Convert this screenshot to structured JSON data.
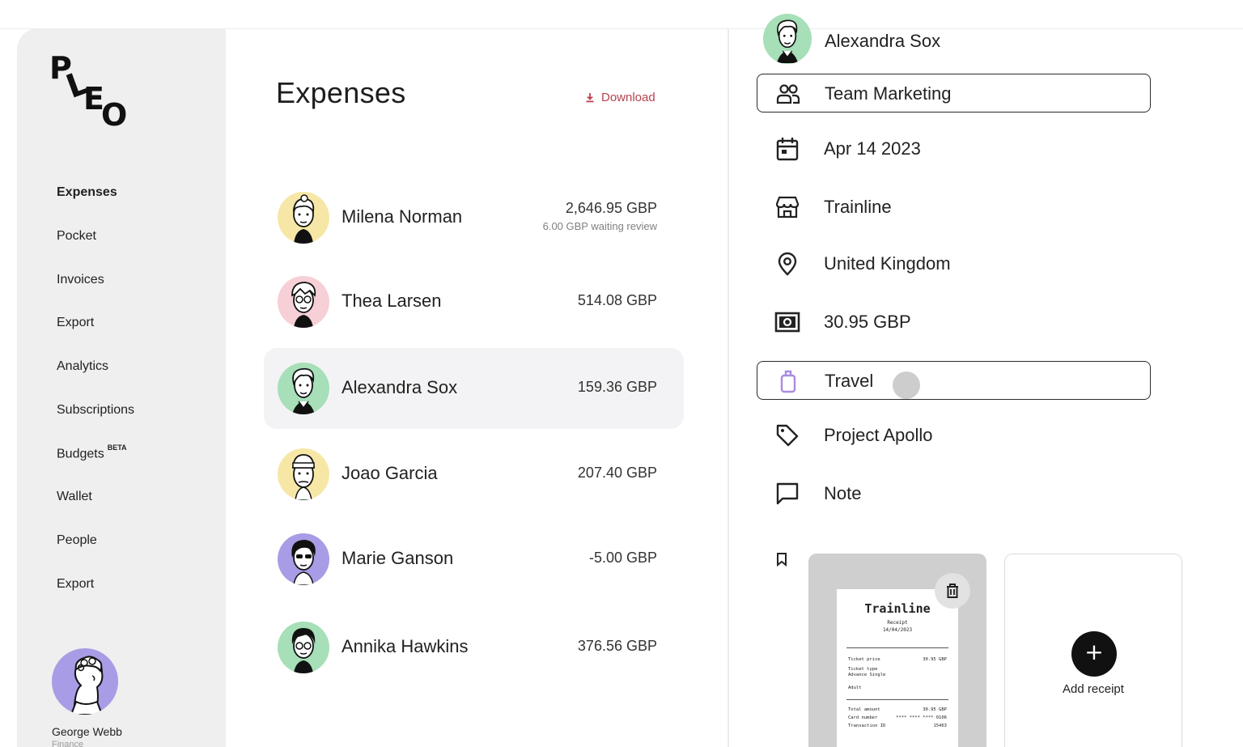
{
  "sidebar": {
    "logo": "PLEO",
    "items": [
      {
        "label": "Expenses",
        "active": true
      },
      {
        "label": "Pocket"
      },
      {
        "label": "Invoices"
      },
      {
        "label": "Export"
      },
      {
        "label": "Analytics"
      },
      {
        "label": "Subscriptions"
      },
      {
        "label": "Budgets",
        "badge": "BETA"
      },
      {
        "label": "Wallet"
      },
      {
        "label": "People"
      },
      {
        "label": "Export"
      }
    ],
    "user": {
      "name": "George Webb",
      "role": "Finance"
    }
  },
  "list": {
    "title": "Expenses",
    "download_label": "Download",
    "rows": [
      {
        "name": "Milena Norman",
        "amount": "2,646.95 GBP",
        "sub": "6.00 GBP waiting review",
        "avatar_color": "#f7e7a6"
      },
      {
        "name": "Thea Larsen",
        "amount": "514.08 GBP",
        "avatar_color": "#f7cfd6"
      },
      {
        "name": "Alexandra Sox",
        "amount": "159.36 GBP",
        "avatar_color": "#a6dfb8",
        "selected": true
      },
      {
        "name": "Joao Garcia",
        "amount": "207.40 GBP",
        "avatar_color": "#f7e7a6"
      },
      {
        "name": "Marie Ganson",
        "amount": "-5.00 GBP",
        "avatar_color": "#a89ce6"
      },
      {
        "name": "Annika Hawkins",
        "amount": "376.56 GBP",
        "avatar_color": "#a6dfb8"
      }
    ]
  },
  "detail": {
    "name": "Alexandra Sox",
    "fields": [
      {
        "icon": "team-icon",
        "label": "Team Marketing"
      },
      {
        "icon": "calendar-icon",
        "label": "Apr 14 2023"
      },
      {
        "icon": "store-icon",
        "label": "Trainline"
      },
      {
        "icon": "location-pin-icon",
        "label": "United Kingdom"
      },
      {
        "icon": "cash-icon",
        "label": "30.95 GBP"
      },
      {
        "icon": "luggage-icon",
        "label": "Travel"
      },
      {
        "icon": "tag-icon",
        "label": "Project Apollo"
      },
      {
        "icon": "note-icon",
        "label": "Note"
      }
    ],
    "receipt": {
      "merchant": "Trainline",
      "heading": "Receipt",
      "date": "14/04/2023",
      "lines": [
        {
          "k": "Ticket price",
          "v": "30.95 GBP"
        },
        {
          "k": "Ticket type",
          "v": ""
        },
        {
          "k": "Advance Single",
          "v": ""
        },
        {
          "k": "Adult",
          "v": ""
        },
        {
          "k": "Total amount",
          "v": "30.95 GBP"
        },
        {
          "k": "Card number",
          "v": "**** **** **** 0106"
        },
        {
          "k": "Transaction ID",
          "v": "15463"
        }
      ]
    },
    "add_receipt_label": "Add receipt"
  },
  "colors": {
    "accent_link": "#b8424f",
    "sidebar_bg": "#efefef",
    "selected_row": "#f3f3f5",
    "travel_icon": "#a98be0"
  }
}
